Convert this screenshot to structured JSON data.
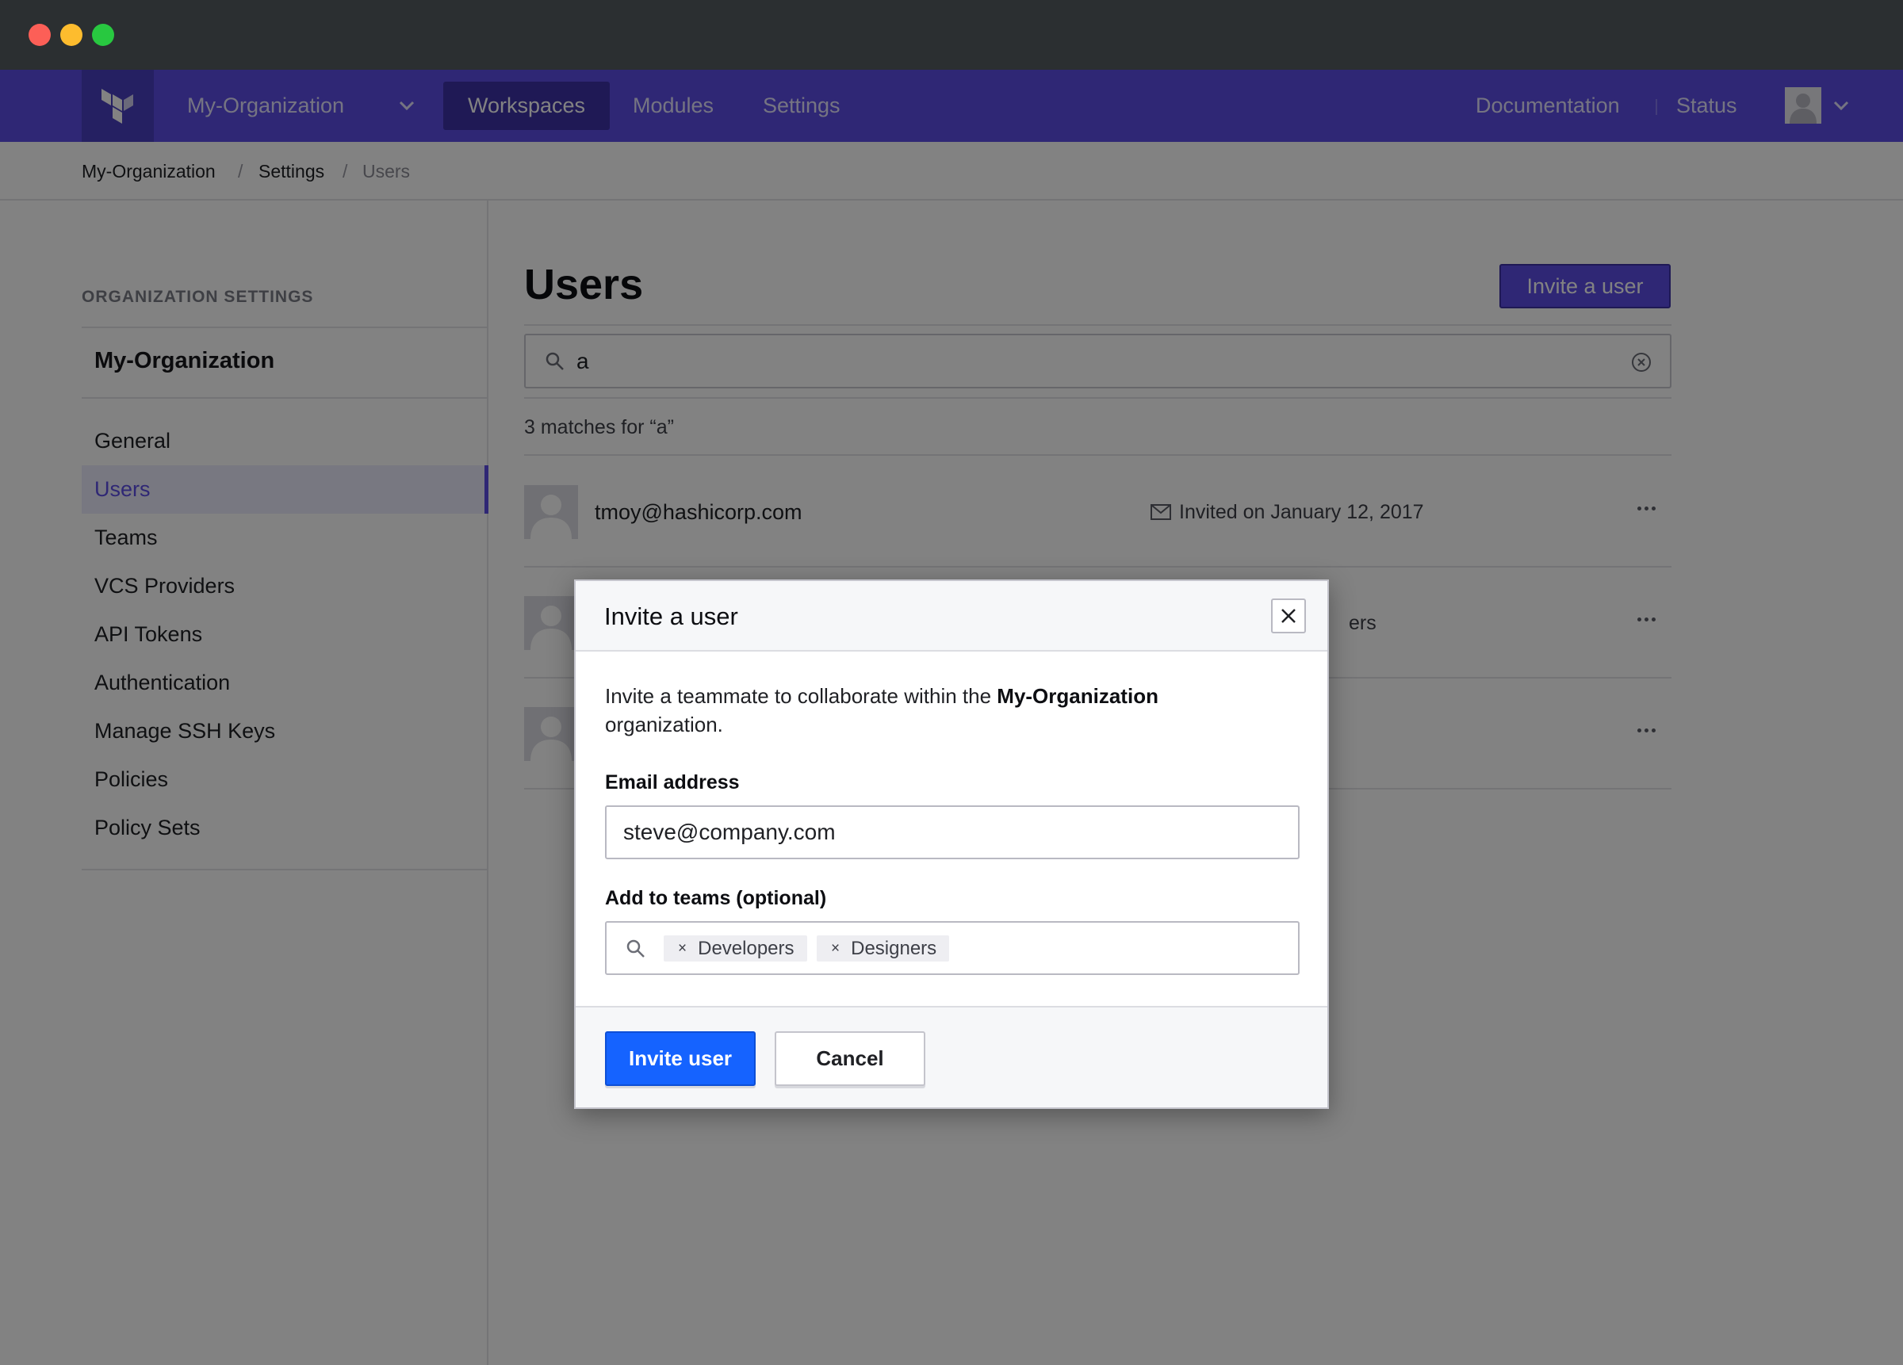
{
  "nav": {
    "org_name": "My-Organization",
    "tabs": [
      "Workspaces",
      "Modules",
      "Settings"
    ],
    "active_tab": "Workspaces",
    "right_links": [
      "Documentation",
      "Status"
    ]
  },
  "breadcrumb": [
    "My-Organization",
    "Settings",
    "Users"
  ],
  "sidebar": {
    "heading": "ORGANIZATION SETTINGS",
    "org_name": "My-Organization",
    "items": [
      {
        "label": "General"
      },
      {
        "label": "Users",
        "active": true
      },
      {
        "label": "Teams"
      },
      {
        "label": "VCS Providers"
      },
      {
        "label": "API Tokens"
      },
      {
        "label": "Authentication"
      },
      {
        "label": "Manage SSH Keys"
      },
      {
        "label": "Policies"
      },
      {
        "label": "Policy Sets"
      }
    ]
  },
  "main": {
    "title": "Users",
    "invite_button": "Invite a user",
    "search_value": "a",
    "matches_text": "3 matches for “a”",
    "rows": [
      {
        "email": "tmoy@hashicorp.com",
        "status": "Invited on January 12, 2017"
      },
      {
        "email": "",
        "status": "ers"
      },
      {
        "email": "",
        "status": ""
      }
    ]
  },
  "modal": {
    "title": "Invite a user",
    "intro_prefix": "Invite a teammate to collaborate within the ",
    "intro_org": "My-Organization",
    "intro_suffix": "organization.",
    "email_label": "Email address",
    "email_value": "steve@company.com",
    "teams_label": "Add to teams (optional)",
    "teams": [
      "Developers",
      "Designers"
    ],
    "primary_button": "Invite user",
    "secondary_button": "Cancel"
  },
  "colors": {
    "nav_bg": "#5c4ee5",
    "primary_blue": "#1563ff",
    "overlay": "rgba(0,0,0,0.49)"
  },
  "icons": {
    "logo": "terraform-logo-icon",
    "search": "search-icon",
    "clear": "clear-circle-icon",
    "close": "close-icon",
    "more": "more-horizontal-icon",
    "mail": "mail-icon",
    "chevron": "chevron-down-icon",
    "avatar": "user-avatar-icon"
  }
}
